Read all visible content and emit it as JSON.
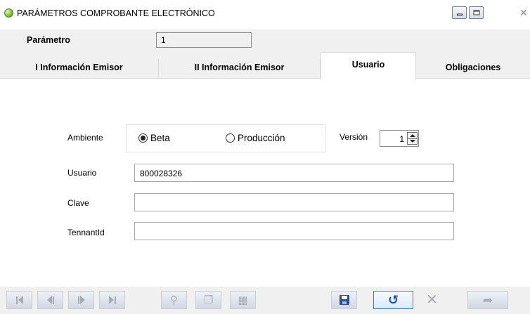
{
  "window": {
    "title": "PARÁMETROS COMPROBANTE ELECTRÓNICO",
    "icon": "app-globe-icon",
    "controls": {
      "minimize_icon": "minimize-icon",
      "maximize_icon": "maximize-icon",
      "close_glyph": "✕"
    }
  },
  "parametro": {
    "label": "Parámetro",
    "value": "1"
  },
  "tabs": [
    {
      "label": "I Información Emisor",
      "active": false
    },
    {
      "label": "II Información Emisor",
      "active": false
    },
    {
      "label": "Usuario",
      "active": true
    },
    {
      "label": "Obligaciones",
      "active": false
    }
  ],
  "form": {
    "ambiente": {
      "label": "Ambiente",
      "options": [
        {
          "label": "Beta",
          "selected": true
        },
        {
          "label": "Producción",
          "selected": false
        }
      ]
    },
    "version": {
      "label": "Versión",
      "value": "1"
    },
    "usuario": {
      "label": "Usuario",
      "value": "800028326"
    },
    "clave": {
      "label": "Clave",
      "value": ""
    },
    "tennantid": {
      "label": "TennantId",
      "value": ""
    }
  },
  "toolbar": {
    "buttons": [
      {
        "icon": "first-record-icon",
        "enabled": false
      },
      {
        "icon": "previous-record-icon",
        "enabled": false
      },
      {
        "icon": "next-record-icon",
        "enabled": false
      },
      {
        "icon": "last-record-icon",
        "enabled": false
      },
      {
        "icon": "search-key-icon",
        "enabled": false
      },
      {
        "icon": "copy-icon",
        "enabled": false
      },
      {
        "icon": "calculator-icon",
        "enabled": false
      },
      {
        "icon": "save-icon",
        "enabled": true
      },
      {
        "icon": "undo-icon",
        "enabled": true
      },
      {
        "icon": "cancel-icon",
        "enabled": false
      },
      {
        "icon": "exit-icon",
        "enabled": false
      }
    ]
  },
  "colors": {
    "accent_blue": "#1f4fb5",
    "panel_gray": "#f0f0f0",
    "disabled_icon": "#a6abb3"
  }
}
